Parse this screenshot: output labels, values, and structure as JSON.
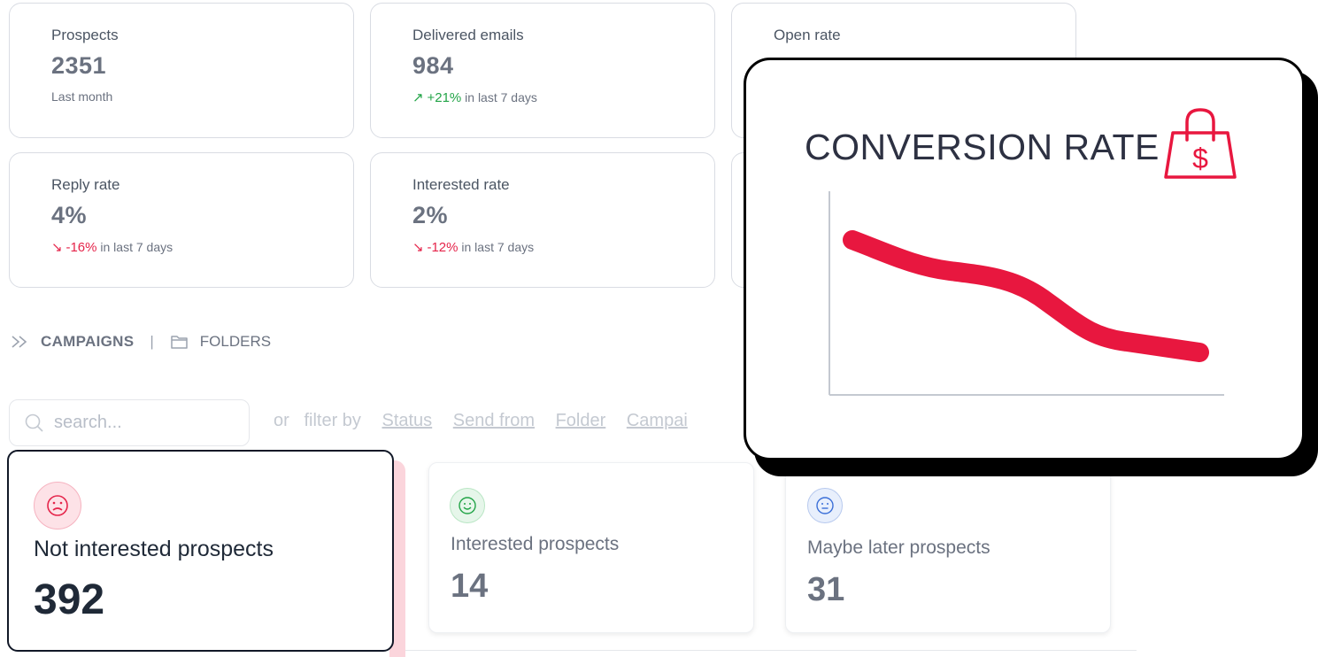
{
  "stats": [
    {
      "label": "Prospects",
      "value": "2351",
      "sub_text": "Last month"
    },
    {
      "label": "Delivered emails",
      "value": "984",
      "trend_arrow": "↗",
      "trend_value": "+21%",
      "trend_text": " in last 7 days",
      "trend_dir": "up"
    },
    {
      "label": "Open rate"
    },
    {
      "label": "Reply rate",
      "value": "4%",
      "trend_arrow": "↘",
      "trend_value": "-16%",
      "trend_text": " in last 7 days",
      "trend_dir": "down"
    },
    {
      "label": "Interested rate",
      "value": "2%",
      "trend_arrow": "↘",
      "trend_value": "-12%",
      "trend_text": " in last 7 days",
      "trend_dir": "down"
    }
  ],
  "tabs": {
    "campaigns": "CAMPAIGNS",
    "separator": "|",
    "folders": "FOLDERS"
  },
  "search": {
    "placeholder": "search..."
  },
  "filter": {
    "prefix": "or   filter by",
    "links": [
      "Status",
      "Send from",
      "Folder",
      "Campai"
    ]
  },
  "prospect_cards": [
    {
      "label": "Not interested prospects",
      "value": "392",
      "icon": "sad-face-icon",
      "icon_color": "#e5244a"
    },
    {
      "label": "Interested prospects",
      "value": "14",
      "icon": "smile-face-icon",
      "icon_color": "#22a447"
    },
    {
      "label": "Maybe later prospects",
      "value": "31",
      "icon": "neutral-face-icon",
      "icon_color": "#3b6fd8"
    }
  ],
  "conversion": {
    "title": "CONVERSION RATE",
    "icon": "shopping-bag-dollar-icon",
    "line_color": "#e8173f",
    "trend": "decreasing"
  },
  "colors": {
    "accent_red": "#e8173f",
    "positive_green": "#22a447",
    "highlight_pink": "#fbd5dc"
  }
}
